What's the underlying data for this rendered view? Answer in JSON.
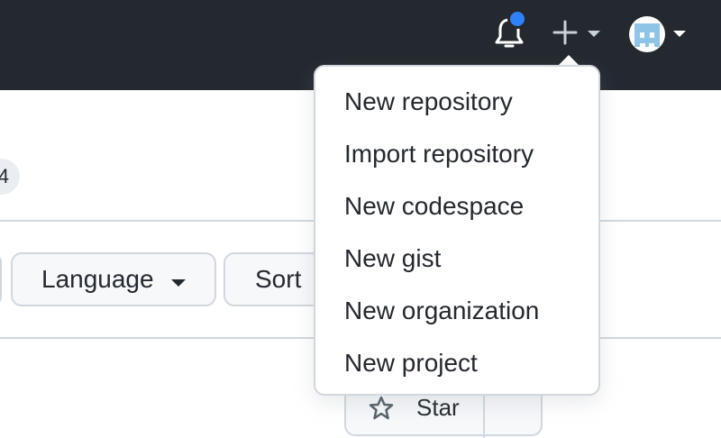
{
  "header": {
    "notifications_icon": "bell-icon",
    "notification_dot_color": "#2f81f7",
    "create_icon": "plus-icon",
    "avatar_icon": "identicon-avatar"
  },
  "background": {
    "count_badge": "4",
    "filters": {
      "language_label": "Language",
      "sort_label": "Sort"
    },
    "repo": {
      "star_label": "Star"
    }
  },
  "create_menu": {
    "items": [
      {
        "label": "New repository"
      },
      {
        "label": "Import repository"
      },
      {
        "label": "New codespace"
      },
      {
        "label": "New gist"
      },
      {
        "label": "New organization"
      },
      {
        "label": "New project"
      }
    ]
  },
  "colors": {
    "header_bg": "#24292f",
    "border": "#d0d7de",
    "accent_blue": "#2f81f7"
  }
}
